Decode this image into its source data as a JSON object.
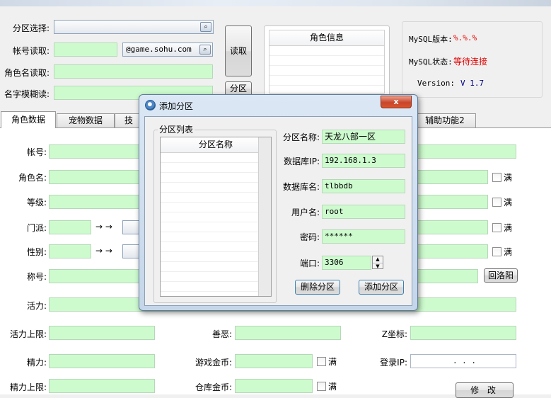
{
  "top": {
    "partition_select_label": "分区选择:",
    "account_read_label": "帐号读取:",
    "account_domain": "@game.sohu.com",
    "role_name_read_label": "角色名读取:",
    "fuzzy_name_label": "名字模糊读:",
    "read_button": "读取",
    "partition_button": "分区",
    "role_info_header": "角色信息",
    "mysql_version_label": "MySQL版本:",
    "mysql_version_value": "%.%.%",
    "mysql_status_label": "MySQL状态:",
    "mysql_status_value": "等待连接",
    "version_label": "Version:",
    "version_value": "V 1.7"
  },
  "tabs": {
    "role_data": "角色数据",
    "pet_data": "宠物数据",
    "skill_partial": "技",
    "helper2": "辅助功能2"
  },
  "form": {
    "account": "帐号:",
    "role_name": "角色名:",
    "level": "等级:",
    "sect": "门派:",
    "gender": "性别:",
    "title": "称号:",
    "vigor": "活力:",
    "vigor_max": "活力上限:",
    "energy": "精力:",
    "energy_max": "精力上限:",
    "good_evil": "善恶:",
    "game_gold": "游戏金币:",
    "bank_gold": "仓库金币:",
    "z_coord": "Z坐标:",
    "login_ip": "登录IP:",
    "login_ip_value": ".      .      .",
    "full": "满",
    "arrow": "→ →",
    "return_luoyang": "回洛阳",
    "modify_button": "修 改"
  },
  "dialog": {
    "title": "添加分区",
    "close": "x",
    "group_label": "分区列表",
    "list_header": "分区名称",
    "name_label": "分区名称:",
    "name_value": "天龙八部一区",
    "ip_label": "数据库IP:",
    "ip_value": "192.168.1.3",
    "db_label": "数据库名:",
    "db_value": "tlbbdb",
    "user_label": "用户名:",
    "user_value": "root",
    "pwd_label": "密码:",
    "pwd_value": "******",
    "port_label": "端口:",
    "port_value": "3306",
    "delete_button": "删除分区",
    "add_button": "添加分区"
  },
  "colors": {
    "field_green": "#cdfbce",
    "status_red": "#e00000",
    "version_blue": "#000080"
  }
}
